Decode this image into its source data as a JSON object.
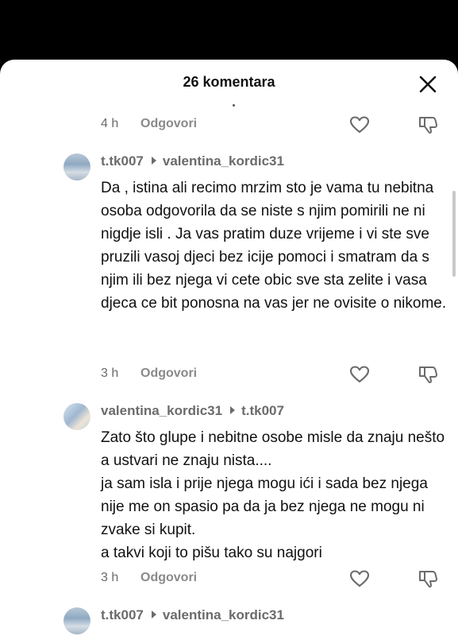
{
  "header": {
    "title": "26 komentara"
  },
  "comments": [
    {
      "time": "4 h",
      "reply_label": "Odgovori"
    },
    {
      "author": "t.tk007",
      "reply_to": "valentina_kordic31",
      "text": "Da , istina ali recimo mrzim sto je vama tu nebitna osoba odgovorila da se niste s njim pomirili ne ni nigdje isli . Ja vas pratim duze vrijeme i vi ste sve pruzili vasoj djeci bez icije pomoci i smatram da s njim ili bez njega vi cete obic sve sta zelite i vasa djeca ce bit ponosna na vas jer ne ovisite o nikome.",
      "time": "3 h",
      "reply_label": "Odgovori"
    },
    {
      "author": "valentina_kordic31",
      "reply_to": "t.tk007",
      "lines": [
        "Zato što glupe i nebitne osobe misle da znaju nešto a ustvari ne znaju nista....",
        "ja sam isla i prije njega mogu ići i sada bez njega nije me on spasio pa da ja bez njega ne mogu ni zvake si kupit.",
        "a takvi koji to pišu tako su najgori"
      ],
      "time": "3 h",
      "reply_label": "Odgovori"
    },
    {
      "author": "t.tk007",
      "reply_to": "valentina_kordic31"
    }
  ]
}
